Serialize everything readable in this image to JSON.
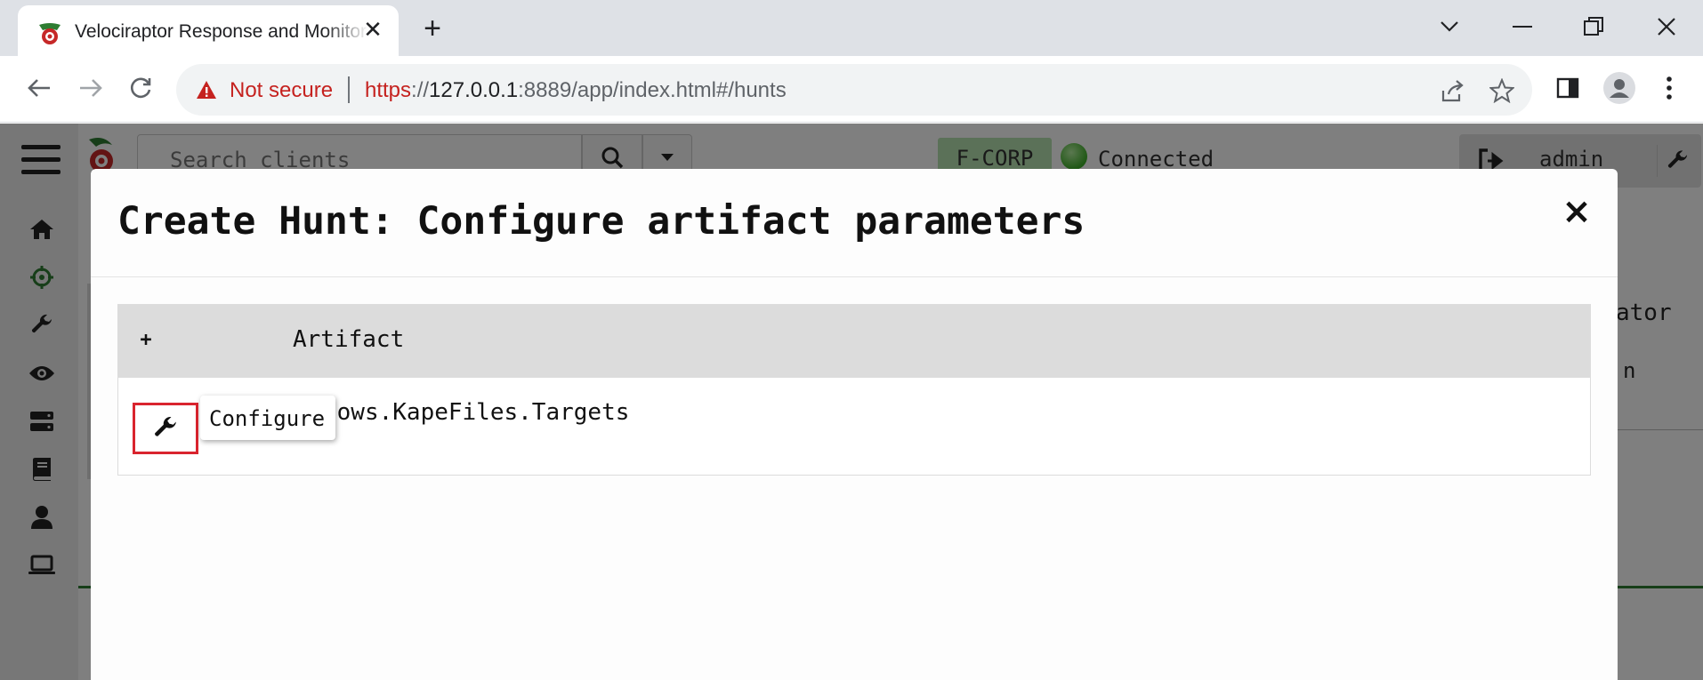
{
  "browser": {
    "tab_title": "Velociraptor Response and Monitoring",
    "new_tab_label": "+",
    "tab_close_label": "✕",
    "security_label": "Not secure",
    "url": {
      "scheme": "https",
      "separator": "://",
      "host": "127.0.0.1",
      "rest": ":8889/app/index.html#/hunts"
    }
  },
  "app": {
    "search_placeholder": "Search clients",
    "org": "F-CORP",
    "connection_status": "Connected",
    "username": "admin",
    "background_column_header": "ator",
    "background_cell": "n",
    "sidebar_icons": [
      "menu-icon",
      "home-icon",
      "hunts-icon",
      "wrench-icon",
      "eye-icon",
      "server-icon",
      "book-icon",
      "user-icon",
      "laptop-icon"
    ]
  },
  "modal": {
    "title": "Create Hunt: Configure artifact parameters",
    "close_label": "×",
    "table": {
      "add_label": "+",
      "header_artifact": "Artifact",
      "row_artifact": "Windows.KapeFiles.Targets",
      "row_artifact_visible": "lows.KapeFiles.Targets"
    },
    "configure_tooltip": "Configure"
  },
  "colors": {
    "highlight_border": "#d9242e",
    "connected_green": "#3fb02a",
    "org_badge": "#b6e3b0",
    "not_secure_red": "#c5221f"
  }
}
